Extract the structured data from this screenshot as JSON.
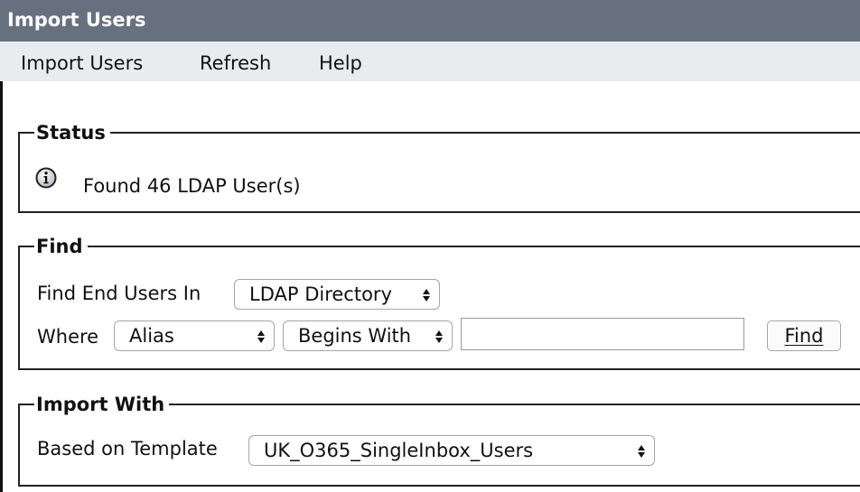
{
  "window": {
    "title": "Import Users"
  },
  "menu": {
    "items": [
      "Import Users",
      "Refresh",
      "Help"
    ]
  },
  "status": {
    "legend": "Status",
    "icon": "info-icon",
    "message": "Found 46 LDAP User(s)"
  },
  "find": {
    "legend": "Find",
    "find_in_label": "Find End Users In",
    "find_in_value": "LDAP Directory",
    "where_label": "Where",
    "where_field": "Alias",
    "where_operator": "Begins With",
    "search_value": "",
    "button_label": "Find"
  },
  "import_with": {
    "legend": "Import With",
    "template_label": "Based on Template",
    "template_value": "UK_O365_SingleInbox_Users"
  },
  "colors": {
    "titlebar_bg": "#67707f",
    "menubar_bg": "#e9ebee"
  }
}
